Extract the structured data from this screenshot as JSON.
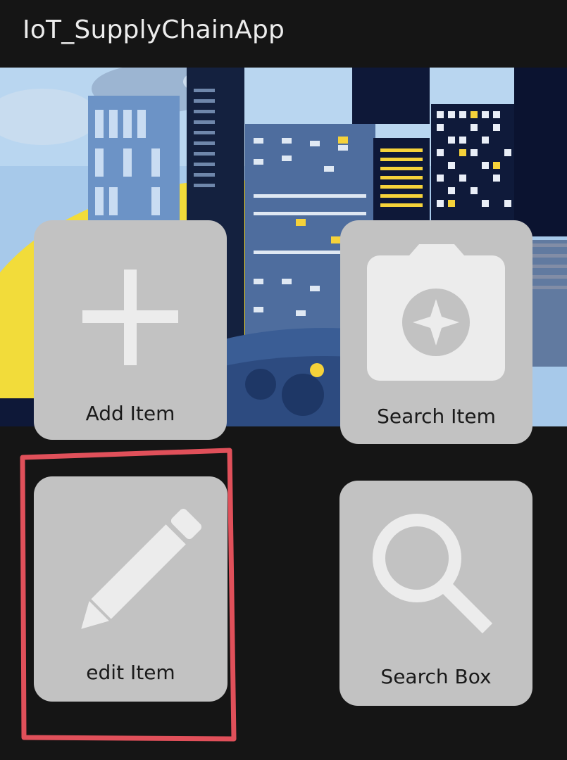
{
  "app": {
    "title": "IoT_SupplyChainApp"
  },
  "banner": {
    "icon": "city-skyline-illustration",
    "colors": {
      "sky": "#a7c9ea",
      "moon": "#f2dc3a",
      "dark": "#0e1838",
      "building": "#4e6d9e",
      "accent": "#f5d23a"
    }
  },
  "tiles": [
    {
      "id": "add",
      "label": "Add Item",
      "icon": "plus-icon"
    },
    {
      "id": "search",
      "label": "Search Item",
      "icon": "camera-icon"
    },
    {
      "id": "edit",
      "label": "edit Item",
      "icon": "pencil-icon"
    },
    {
      "id": "box",
      "label": "Search Box",
      "icon": "magnifier-icon"
    }
  ],
  "colors": {
    "background": "#151515",
    "tile": "#c2c2c2",
    "tile_icon": "#ececec",
    "highlight": "#e0505a"
  }
}
